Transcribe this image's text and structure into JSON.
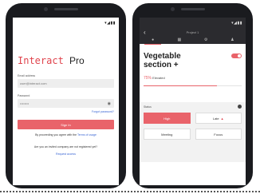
{
  "left_phone": {
    "status": {
      "signal": "▾◢▮▮"
    },
    "brand": {
      "word": "Interact",
      "suffix": "Pro"
    },
    "email": {
      "label": "Email address",
      "value": "user@interact.com"
    },
    "password": {
      "label": "Password",
      "value": "••••••••"
    },
    "forgot": "Forgot password?",
    "signin_button": "Sign In",
    "terms": {
      "text": "By proceeding you agree with the",
      "link": "Terms of usage"
    },
    "invite_question": "Are you an invited company are not registered yet?",
    "request_link": "Request access"
  },
  "right_phone": {
    "status": {
      "signal": "▾◢▮▮"
    },
    "appbar": {
      "back": "‹",
      "title": "Project 1"
    },
    "tabs": [
      {
        "icon": "●",
        "name": "tab-info"
      },
      {
        "icon": "▦",
        "name": "tab-grid"
      },
      {
        "icon": "⚙",
        "name": "tab-settings"
      },
      {
        "icon": "♟",
        "name": "tab-people"
      }
    ],
    "section": {
      "title": "Vegetable section",
      "plus": "+",
      "enabled": true
    },
    "percent": {
      "value": "75%",
      "label": "Elevated",
      "fraction": 0.75
    },
    "priority_label": "Status",
    "options": [
      {
        "label": "High",
        "selected": true
      },
      {
        "label": "Late",
        "flame": "▲",
        "selected": false
      },
      {
        "label": "Meeting",
        "selected": false
      },
      {
        "label": "Focus",
        "selected": false
      }
    ],
    "accent": "#e9636a"
  }
}
